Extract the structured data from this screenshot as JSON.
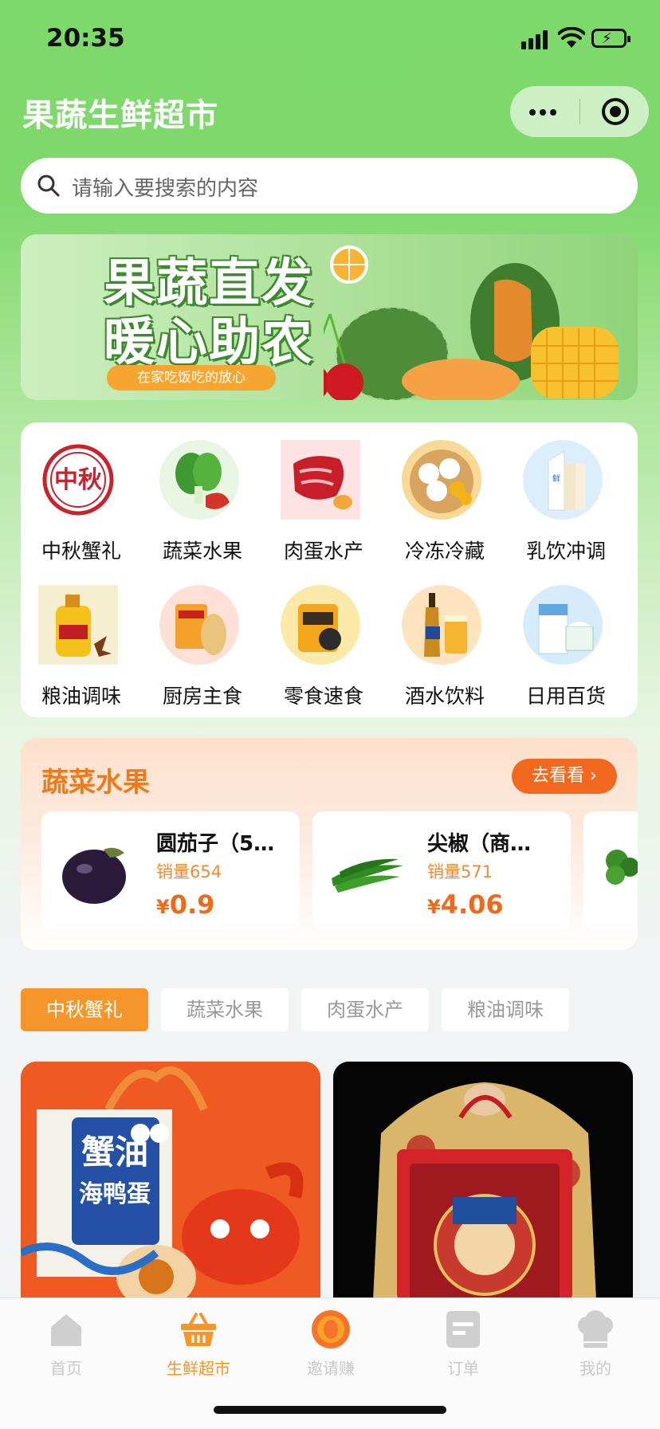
{
  "status_bar": {
    "time": "20:35"
  },
  "header": {
    "title": "果蔬生鲜超市",
    "menu_icon": "more-dots-icon",
    "close_icon": "target-circle-icon"
  },
  "search": {
    "placeholder": "请输入要搜索的内容"
  },
  "banner": {
    "title_line1": "果蔬直发",
    "title_line2": "暖心助农",
    "subtitle": "在家吃饭吃的放心"
  },
  "categories": [
    {
      "label": "中秋蟹礼",
      "icon": "mooncake-seal-icon"
    },
    {
      "label": "蔬菜水果",
      "icon": "vegetables-icon"
    },
    {
      "label": "肉蛋水产",
      "icon": "meat-icon"
    },
    {
      "label": "冷冻冷藏",
      "icon": "dumplings-icon"
    },
    {
      "label": "乳饮冲调",
      "icon": "milk-icon"
    },
    {
      "label": "粮油调味",
      "icon": "oil-icon"
    },
    {
      "label": "厨房主食",
      "icon": "bread-icon"
    },
    {
      "label": "零食速食",
      "icon": "snack-icon"
    },
    {
      "label": "酒水饮料",
      "icon": "beer-icon"
    },
    {
      "label": "日用百货",
      "icon": "tissue-icon"
    }
  ],
  "promo": {
    "title": "蔬菜水果",
    "more_label": "去看看",
    "products": [
      {
        "name": "圆茄子（5…",
        "sales": "销量654",
        "currency": "¥",
        "price": "0.9",
        "image": "eggplant"
      },
      {
        "name": "尖椒（商…",
        "sales": "销量571",
        "currency": "¥",
        "price": "4.06",
        "image": "green-pepper"
      }
    ]
  },
  "filter_tabs": [
    {
      "label": "中秋蟹礼",
      "active": true
    },
    {
      "label": "蔬菜水果",
      "active": false
    },
    {
      "label": "肉蛋水产",
      "active": false
    },
    {
      "label": "粮油调味",
      "active": false
    }
  ],
  "product_grid": [
    {
      "image": "crab-oil-duck-egg-gift-box",
      "box_text_1": "蟹油",
      "box_text_2": "海鸭蛋"
    },
    {
      "image": "mooncake-gift-box"
    }
  ],
  "tab_bar": [
    {
      "label": "首页",
      "icon": "home-icon",
      "active": false
    },
    {
      "label": "生鲜超市",
      "icon": "basket-icon",
      "active": true
    },
    {
      "label": "邀请赚",
      "icon": "coin-icon",
      "active": false
    },
    {
      "label": "订单",
      "icon": "order-icon",
      "active": false
    },
    {
      "label": "我的",
      "icon": "chef-hat-icon",
      "active": false
    }
  ],
  "colors": {
    "brand_green": "#7ed96b",
    "accent_orange": "#f6962a",
    "price_orange": "#ee6a1a"
  }
}
